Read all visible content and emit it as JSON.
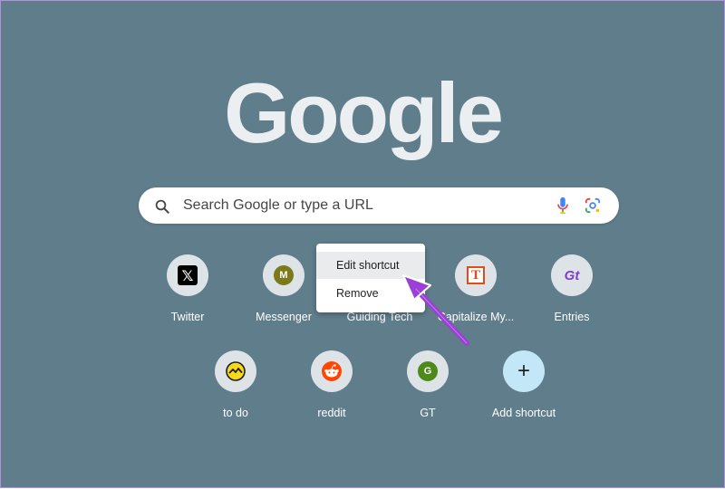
{
  "colors": {
    "background": "#607d8b",
    "logo": "#eceff1",
    "shortcut_label": "#ffffff",
    "arrow": "#9b3fd6",
    "border": "#b68ee0"
  },
  "logo_text": "Google",
  "search": {
    "placeholder": "Search Google or type a URL",
    "icons": [
      "search-icon",
      "microphone-icon",
      "google-lens-icon"
    ]
  },
  "shortcuts_row1": [
    {
      "label": "Twitter",
      "icon": "x-logo-icon",
      "glyph": "𝕏"
    },
    {
      "label": "Messenger",
      "icon": "messenger-icon",
      "glyph": "M",
      "color": "#7a7a1a"
    },
    {
      "label": "Guiding Tech",
      "icon": "guiding-tech-icon",
      "glyph": ""
    },
    {
      "label": "Capitalize My...",
      "icon": "capitalize-my-title-icon",
      "glyph": "T"
    },
    {
      "label": "Entries",
      "icon": "entries-icon",
      "glyph": "Gt",
      "color": "#7e3fd1"
    }
  ],
  "shortcuts_row2": [
    {
      "label": "to do",
      "icon": "basecamp-icon",
      "glyph": ""
    },
    {
      "label": "reddit",
      "icon": "reddit-icon",
      "glyph": ""
    },
    {
      "label": "GT",
      "icon": "gt-icon",
      "glyph": "G",
      "color": "#4e8a1a"
    },
    {
      "label": "Add shortcut",
      "icon": "plus-icon",
      "glyph": "+"
    }
  ],
  "context_menu": {
    "items": [
      "Edit shortcut",
      "Remove"
    ],
    "highlighted_index": 0
  }
}
